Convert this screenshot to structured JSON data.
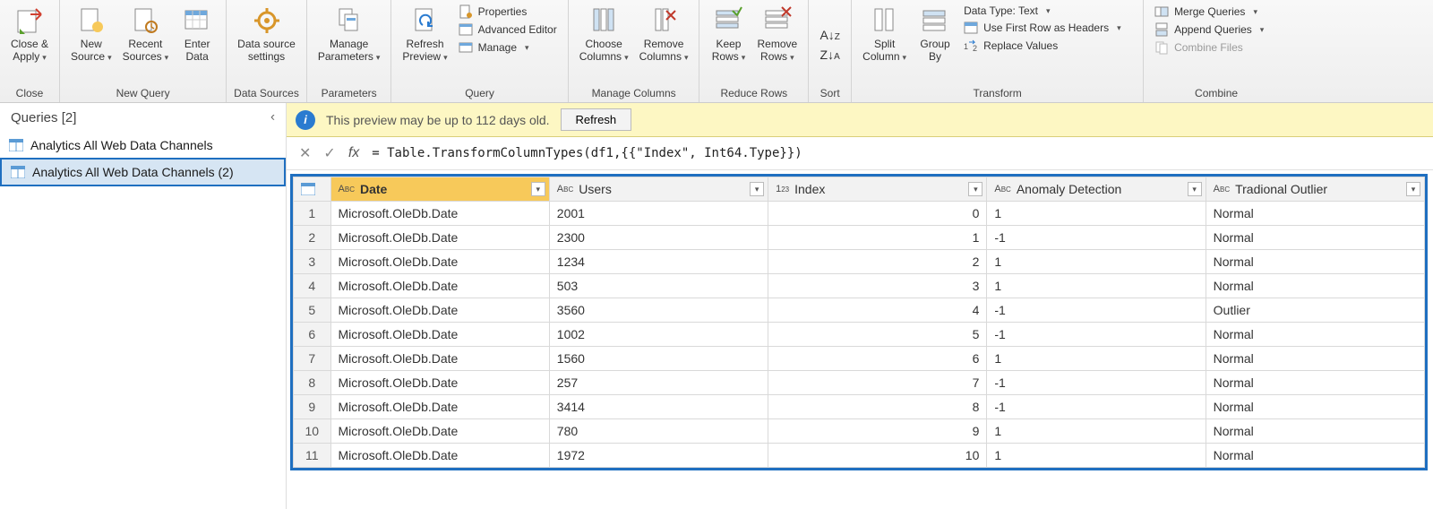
{
  "ribbon": {
    "close": {
      "close_apply": "Close &\nApply",
      "group": "Close"
    },
    "new_query": {
      "new_source": "New\nSource",
      "recent": "Recent\nSources",
      "enter_data": "Enter\nData",
      "group": "New Query"
    },
    "data_sources": {
      "settings": "Data source\nsettings",
      "group": "Data Sources"
    },
    "parameters": {
      "manage": "Manage\nParameters",
      "group": "Parameters"
    },
    "query": {
      "refresh": "Refresh\nPreview",
      "properties": "Properties",
      "advanced": "Advanced Editor",
      "manage": "Manage",
      "group": "Query"
    },
    "manage_columns": {
      "choose": "Choose\nColumns",
      "remove": "Remove\nColumns",
      "group": "Manage Columns"
    },
    "reduce_rows": {
      "keep": "Keep\nRows",
      "remove": "Remove\nRows",
      "group": "Reduce Rows"
    },
    "sort": {
      "group": "Sort"
    },
    "transform": {
      "split": "Split\nColumn",
      "groupby": "Group\nBy",
      "datatype": "Data Type: Text",
      "firstrow": "Use First Row as Headers",
      "replace": "Replace Values",
      "group": "Transform"
    },
    "combine": {
      "merge": "Merge Queries",
      "append": "Append Queries",
      "combinefiles": "Combine Files",
      "group": "Combine"
    }
  },
  "queries_pane": {
    "header": "Queries [2]",
    "items": [
      {
        "label": "Analytics All Web Data Channels"
      },
      {
        "label": "Analytics All Web Data Channels (2)"
      }
    ]
  },
  "notice": {
    "text": "This preview may be up to 112 days old.",
    "refresh": "Refresh"
  },
  "formula": "= Table.TransformColumnTypes(df1,{{\"Index\", Int64.Type}})",
  "table": {
    "columns": [
      {
        "name": "Date",
        "type": "text"
      },
      {
        "name": "Users",
        "type": "text"
      },
      {
        "name": "Index",
        "type": "int"
      },
      {
        "name": "Anomaly Detection",
        "type": "text"
      },
      {
        "name": "Tradional Outlier",
        "type": "text"
      }
    ],
    "rows": [
      {
        "n": "1",
        "date": "Microsoft.OleDb.Date",
        "users": "2001",
        "index": "0",
        "anom": "1",
        "out": "Normal"
      },
      {
        "n": "2",
        "date": "Microsoft.OleDb.Date",
        "users": "2300",
        "index": "1",
        "anom": "-1",
        "out": "Normal"
      },
      {
        "n": "3",
        "date": "Microsoft.OleDb.Date",
        "users": "1234",
        "index": "2",
        "anom": "1",
        "out": "Normal"
      },
      {
        "n": "4",
        "date": "Microsoft.OleDb.Date",
        "users": "503",
        "index": "3",
        "anom": "1",
        "out": "Normal"
      },
      {
        "n": "5",
        "date": "Microsoft.OleDb.Date",
        "users": "3560",
        "index": "4",
        "anom": "-1",
        "out": "Outlier"
      },
      {
        "n": "6",
        "date": "Microsoft.OleDb.Date",
        "users": "1002",
        "index": "5",
        "anom": "-1",
        "out": "Normal"
      },
      {
        "n": "7",
        "date": "Microsoft.OleDb.Date",
        "users": "1560",
        "index": "6",
        "anom": "1",
        "out": "Normal"
      },
      {
        "n": "8",
        "date": "Microsoft.OleDb.Date",
        "users": "257",
        "index": "7",
        "anom": "-1",
        "out": "Normal"
      },
      {
        "n": "9",
        "date": "Microsoft.OleDb.Date",
        "users": "3414",
        "index": "8",
        "anom": "-1",
        "out": "Normal"
      },
      {
        "n": "10",
        "date": "Microsoft.OleDb.Date",
        "users": "780",
        "index": "9",
        "anom": "1",
        "out": "Normal"
      },
      {
        "n": "11",
        "date": "Microsoft.OleDb.Date",
        "users": "1972",
        "index": "10",
        "anom": "1",
        "out": "Normal"
      }
    ]
  }
}
